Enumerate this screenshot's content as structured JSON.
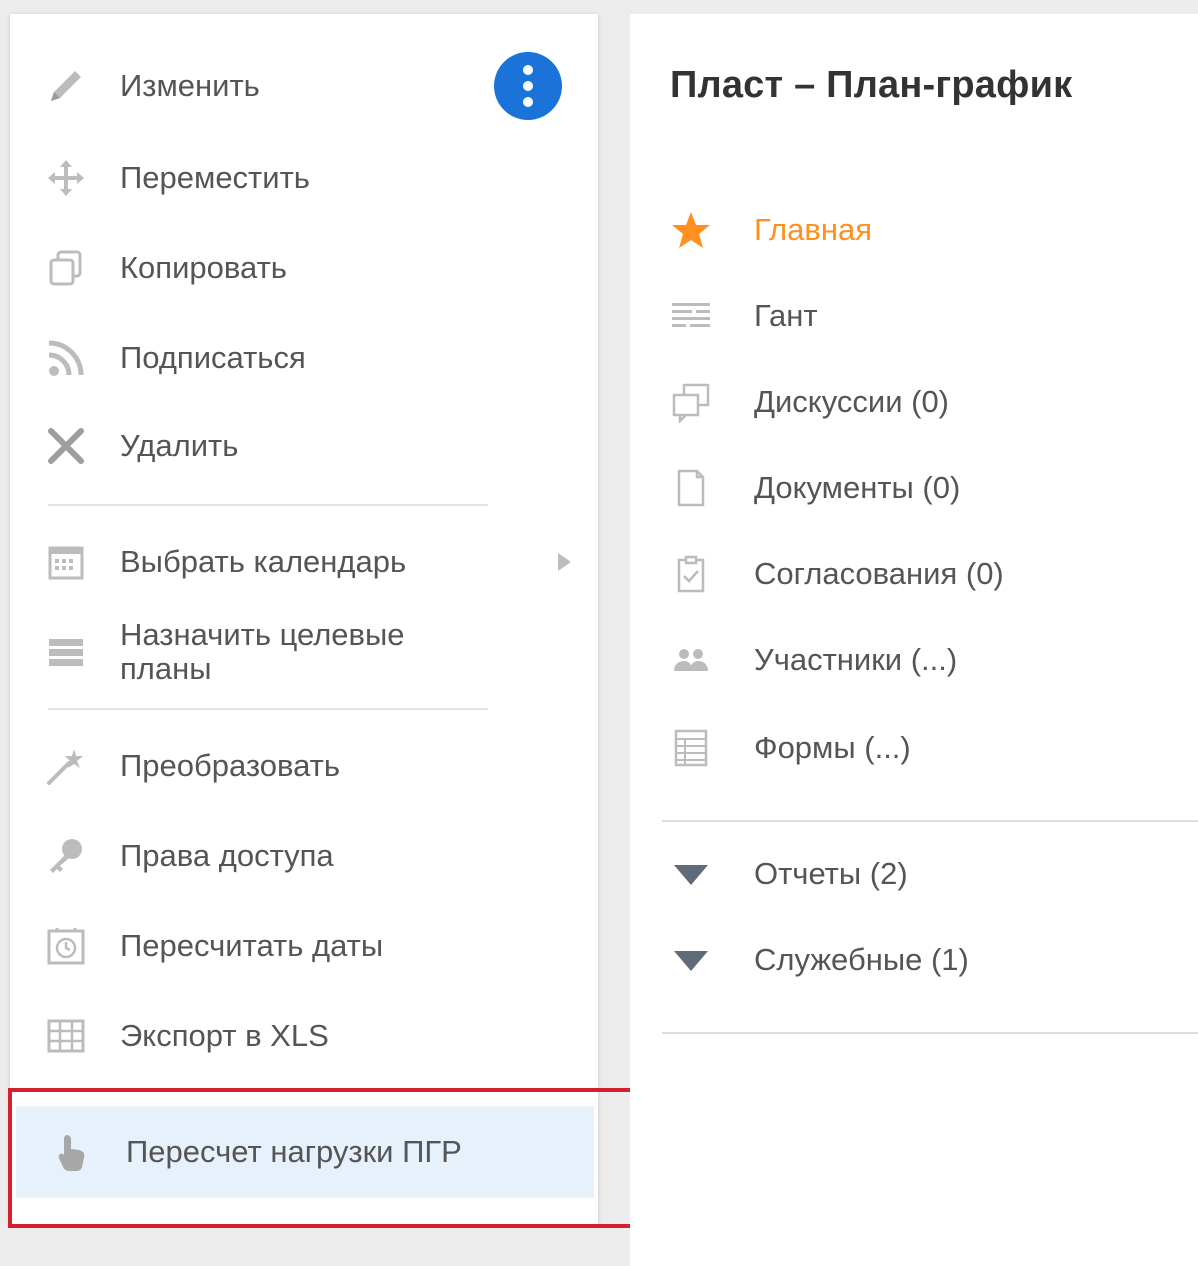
{
  "menu": {
    "items": [
      {
        "label": "Изменить",
        "icon": "pencil-icon"
      },
      {
        "label": "Переместить",
        "icon": "move-icon"
      },
      {
        "label": "Копировать",
        "icon": "copy-icon"
      },
      {
        "label": "Подписаться",
        "icon": "rss-icon"
      },
      {
        "label": "Удалить",
        "icon": "close-icon"
      },
      {
        "label": "Выбрать календарь",
        "icon": "calendar-icon"
      },
      {
        "label": "Назначить целевые планы",
        "icon": "baseline-icon"
      },
      {
        "label": "Преобразовать",
        "icon": "magic-wand-icon"
      },
      {
        "label": "Права доступа",
        "icon": "key-icon"
      },
      {
        "label": "Пересчитать даты",
        "icon": "clock-icon"
      },
      {
        "label": "Экспорт в XLS",
        "icon": "table-icon"
      },
      {
        "label": "Пересчет нагрузки ПГР",
        "icon": "hand-pointer-icon"
      }
    ]
  },
  "panel": {
    "title": "Пласт – План-график",
    "nav": [
      {
        "label": "Главная",
        "icon": "star-icon",
        "active": true
      },
      {
        "label": "Гант",
        "icon": "gantt-icon"
      },
      {
        "label": "Дискуссии (0)",
        "icon": "discussion-icon"
      },
      {
        "label": "Документы (0)",
        "icon": "document-icon"
      },
      {
        "label": "Согласования (0)",
        "icon": "approval-icon"
      },
      {
        "label": "Участники (...)",
        "icon": "users-icon"
      },
      {
        "label": "Формы (...)",
        "icon": "form-icon"
      }
    ],
    "groups": [
      {
        "label": "Отчеты (2)",
        "icon": "triangle-down-icon"
      },
      {
        "label": "Служебные (1)",
        "icon": "triangle-down-icon"
      }
    ]
  },
  "colors": {
    "accent": "#1a73d9",
    "active": "#ff8f1f",
    "highlight": "#e6f1fc",
    "frame": "#d2202e"
  }
}
